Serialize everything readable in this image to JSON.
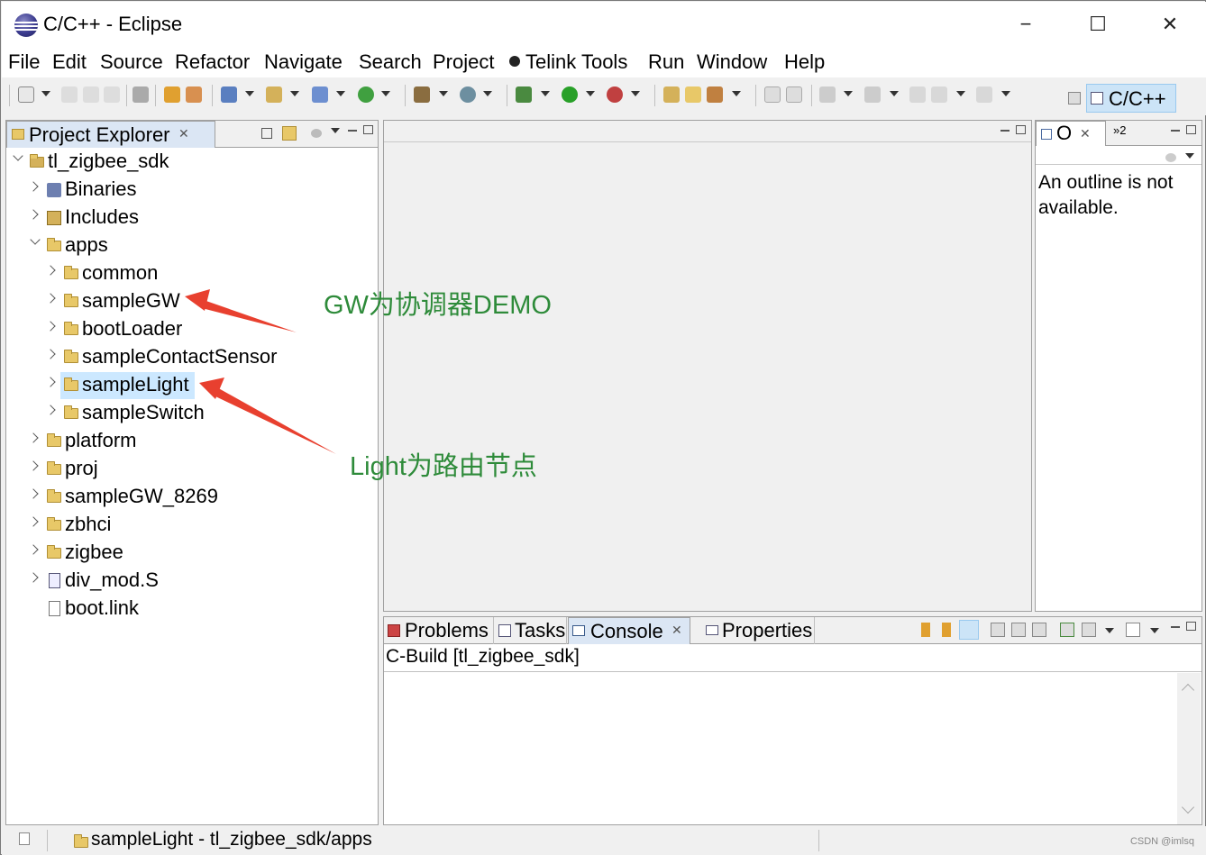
{
  "window": {
    "title": "C/C++ - Eclipse",
    "controls": {
      "minimize": "−",
      "maximize": "☐",
      "close": "✕"
    }
  },
  "menubar": [
    "File",
    "Edit",
    "Source",
    "Refactor",
    "Navigate",
    "Search",
    "Project",
    "Telink Tools",
    "Run",
    "Window",
    "Help"
  ],
  "perspective": {
    "label": "C/C++"
  },
  "project_explorer": {
    "tab_label": "Project Explorer",
    "tree": [
      {
        "label": "tl_zigbee_sdk",
        "icon": "project-folder-icon",
        "level": 0,
        "expanded": true
      },
      {
        "label": "Binaries",
        "icon": "binaries-icon",
        "level": 1,
        "expanded": false
      },
      {
        "label": "Includes",
        "icon": "includes-icon",
        "level": 1,
        "expanded": false
      },
      {
        "label": "apps",
        "icon": "folder-icon",
        "level": 1,
        "expanded": true
      },
      {
        "label": "common",
        "icon": "folder-icon",
        "level": 2,
        "expanded": false
      },
      {
        "label": "sampleGW",
        "icon": "folder-icon",
        "level": 2,
        "expanded": false
      },
      {
        "label": "bootLoader",
        "icon": "folder-icon",
        "level": 2,
        "expanded": false
      },
      {
        "label": "sampleContactSensor",
        "icon": "folder-icon",
        "level": 2,
        "expanded": false
      },
      {
        "label": "sampleLight",
        "icon": "folder-icon",
        "level": 2,
        "expanded": false,
        "selected": true
      },
      {
        "label": "sampleSwitch",
        "icon": "folder-icon",
        "level": 2,
        "expanded": false
      },
      {
        "label": "platform",
        "icon": "folder-icon",
        "level": 1,
        "expanded": false
      },
      {
        "label": "proj",
        "icon": "folder-icon",
        "level": 1,
        "expanded": false
      },
      {
        "label": "sampleGW_8269",
        "icon": "folder-icon",
        "level": 1,
        "expanded": false
      },
      {
        "label": "zbhci",
        "icon": "folder-icon",
        "level": 1,
        "expanded": false
      },
      {
        "label": "zigbee",
        "icon": "folder-icon",
        "level": 1,
        "expanded": false
      },
      {
        "label": "div_mod.S",
        "icon": "asm-file-icon",
        "level": 1,
        "expanded": false
      },
      {
        "label": "boot.link",
        "icon": "file-icon",
        "level": 1,
        "leaf": true
      }
    ]
  },
  "annotations": {
    "gw": "GW为协调器DEMO",
    "light": "Light为路由节点",
    "arrow_color": "#e8402f"
  },
  "outline": {
    "tab_label": "O",
    "overflow_label": "»2",
    "message": "An outline is not available."
  },
  "bottom_panel": {
    "tabs": [
      "Problems",
      "Tasks",
      "Console",
      "Properties"
    ],
    "active_tab": "Console",
    "console_title": "C-Build [tl_zigbee_sdk]"
  },
  "statusbar": {
    "text": "sampleLight - tl_zigbee_sdk/apps"
  },
  "watermark": "CSDN @imlsq",
  "colors": {
    "selection": "#cce8ff",
    "annotation_text": "#2e8b3a",
    "perspective_active": "#cce4f7"
  }
}
